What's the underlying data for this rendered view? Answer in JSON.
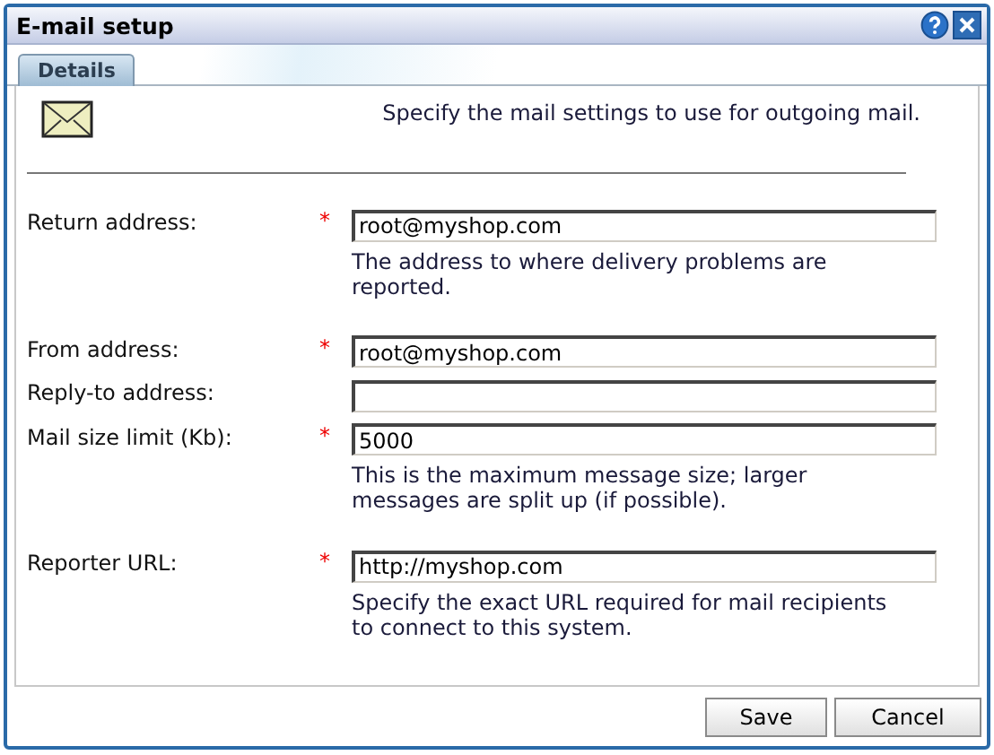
{
  "window": {
    "title": "E-mail setup"
  },
  "tabs": [
    {
      "label": "Details",
      "selected": true
    }
  ],
  "intro": "Specify the mail settings to use for outgoing mail.",
  "fields": [
    {
      "label": "Return address:",
      "marker": "*",
      "value": "root@myshop.com",
      "help": "The address to where delivery problems are reported."
    },
    {
      "label": "From address:",
      "marker": "*",
      "value": "root@myshop.com"
    },
    {
      "label": "Reply-to address:"
    },
    {
      "label": "Mail size limit (Kb):",
      "marker": "*",
      "value": "5000",
      "help": "This is the maximum message size; larger messages are split up (if possible)."
    },
    {
      "label": "Reporter URL:",
      "marker": "*",
      "value": "http://myshop.com",
      "help": "Specify the exact URL required for mail recipients to connect to this system."
    }
  ],
  "buttons": [
    "Save",
    "Cancel"
  ]
}
